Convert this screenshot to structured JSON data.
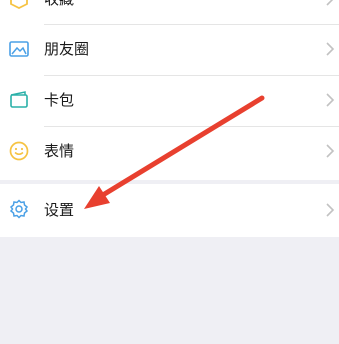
{
  "menu": {
    "items": [
      {
        "label": "收藏",
        "icon": "cube-icon"
      },
      {
        "label": "朋友圈",
        "icon": "image-icon"
      },
      {
        "label": "卡包",
        "icon": "wallet-icon"
      },
      {
        "label": "表情",
        "icon": "smiley-icon"
      }
    ],
    "settings": {
      "label": "设置",
      "icon": "gear-icon"
    }
  },
  "colors": {
    "accent_blue": "#4aa0e6",
    "accent_yellow": "#f6c343",
    "wallet_teal": "#2ab0a8",
    "arrow_red": "#e8402f",
    "page_bg": "#efeff4"
  }
}
